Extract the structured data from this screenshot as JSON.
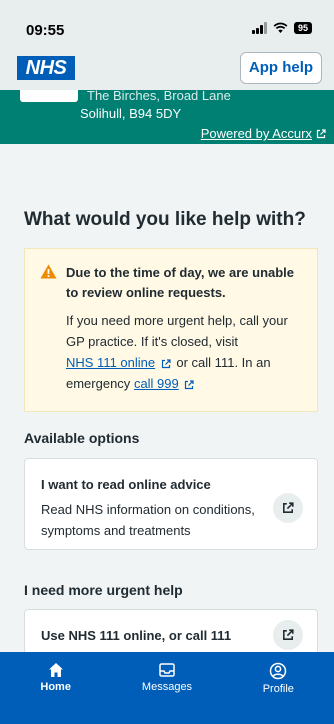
{
  "status": {
    "time": "09:55",
    "battery": "95"
  },
  "header": {
    "logo": "NHS",
    "help_button": "App help"
  },
  "practice": {
    "address_line1": "The Birches, Broad Lane",
    "address_line2": "Solihull, B94 5DY",
    "powered_by": "Powered by Accurx"
  },
  "page": {
    "title": "What would you like help with?"
  },
  "warning": {
    "title": "Due to the time of day, we are unable to review online requests.",
    "body_prefix": "If you need more urgent help, call your GP practice. If it's closed, visit",
    "link_111": "NHS 111 online",
    "body_middle": "or call 111. In an emergency",
    "link_999": "call 999"
  },
  "sections": {
    "available_options": "Available options",
    "urgent_help": "I need more urgent help"
  },
  "options": [
    {
      "title": "I want to read online advice",
      "description": "Read NHS information on conditions, symptoms and treatments"
    },
    {
      "title": "Use NHS 111 online, or call 111",
      "description": ""
    }
  ],
  "tabs": [
    {
      "label": "Home",
      "icon": "home-icon",
      "active": true
    },
    {
      "label": "Messages",
      "icon": "messages-icon",
      "active": false
    },
    {
      "label": "Profile",
      "icon": "profile-icon",
      "active": false
    }
  ],
  "colors": {
    "nhs_blue": "#005eb8",
    "banner_teal": "#007f73",
    "warning_bg": "#fff9e5",
    "warning_icon": "#ed8b00"
  }
}
